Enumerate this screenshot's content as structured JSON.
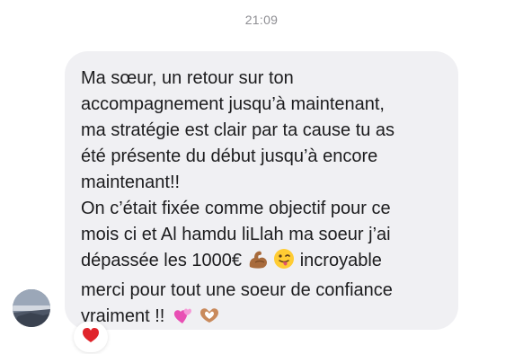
{
  "timestamp": "21:09",
  "message": {
    "lines": [
      "Ma sœur, un retour sur ton",
      "accompagnement jusqu’à maintenant,",
      "ma stratégie est clair par ta cause tu as",
      "été présente du début jusqu’à encore",
      "maintenant!!",
      "On c’était fixée comme objectif pour ce",
      "mois ci et Al hamdu liLlah ma soeur j’ai",
      "dépassée les 1000€",
      "incroyable",
      "merci pour tout une soeur de confiance",
      "vraiment !!"
    ],
    "emojis": [
      "flexed-biceps-icon",
      "winking-tongue-face-icon",
      "two-hearts-icon",
      "heart-hands-icon"
    ]
  },
  "reaction": {
    "icon": "red-heart-icon",
    "color": "#e0242b"
  },
  "colors": {
    "bubble": "#f0f0f3",
    "text": "#1c1c1e",
    "timestamp": "#8e8e93"
  }
}
